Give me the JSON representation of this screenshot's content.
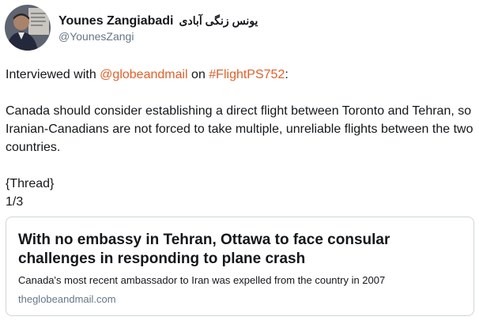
{
  "author": {
    "display_name": "Younes Zangiabadi",
    "display_name_fa": "یونس زنگی آبادی",
    "handle": "@YounesZangi"
  },
  "tweet": {
    "line1_prefix": "Interviewed with ",
    "mention": "@globeandmail",
    "line1_middle": " on ",
    "hashtag": "#FlightPS752",
    "line1_suffix": ":",
    "paragraph": "Canada should consider establishing a direct flight between Toronto and Tehran, so Iranian-Canadians are not forced to take multiple, unreliable flights between the two countries.",
    "thread_label": "{Thread}",
    "thread_count": "1/3"
  },
  "card": {
    "title": "With no embassy in Tehran, Ottawa to face consular challenges in responding to plane crash",
    "description": "Canada's most recent ambassador to Iran was expelled from the country in 2007",
    "domain": "theglobeandmail.com"
  },
  "colors": {
    "link": "#e0602a",
    "text": "#14171a",
    "muted": "#657786",
    "card_border": "#ccd6dd"
  }
}
